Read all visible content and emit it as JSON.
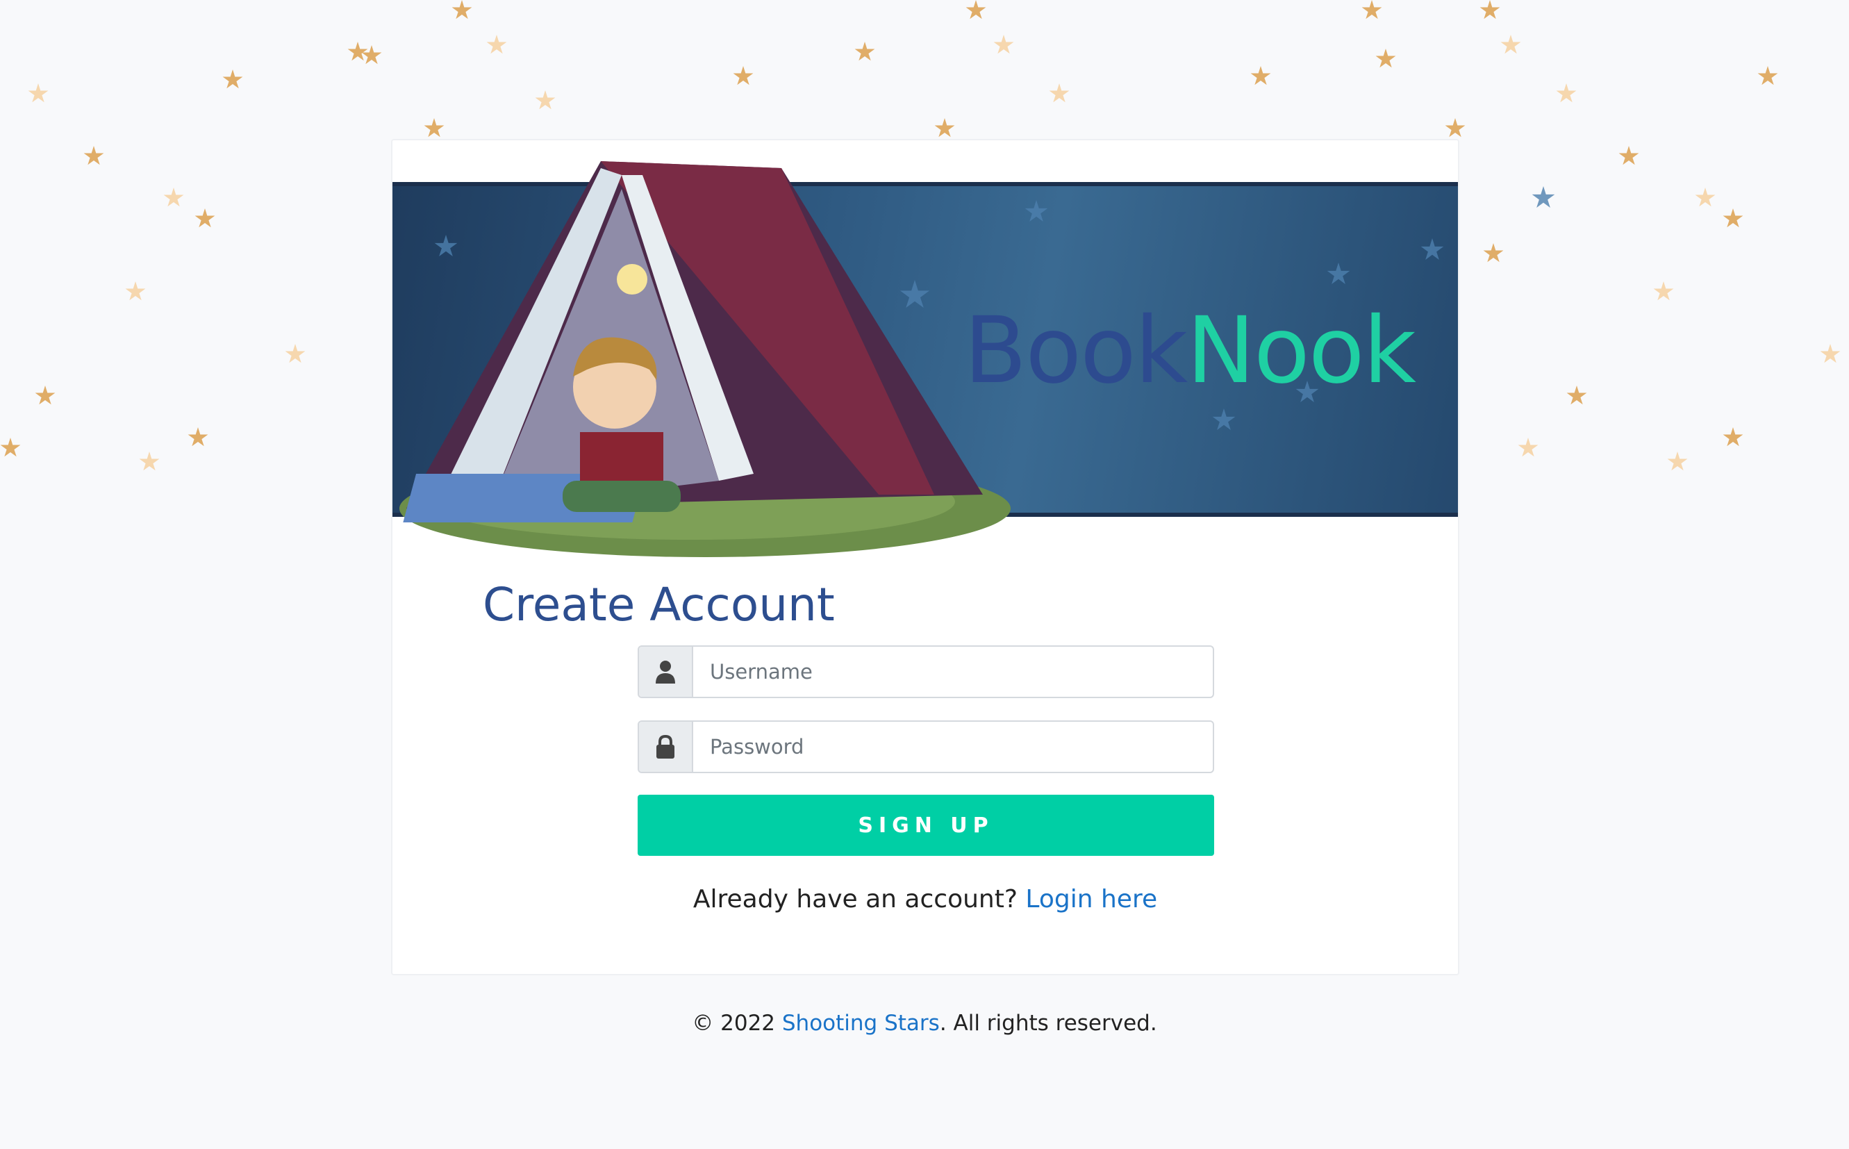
{
  "brand": {
    "part1": "Book",
    "part2": "Nook"
  },
  "form": {
    "title": "Create Account",
    "username_placeholder": "Username",
    "password_placeholder": "Password",
    "submit_label": "SIGN UP",
    "login_prompt": "Already have an account?",
    "login_link": "Login here"
  },
  "footer": {
    "prefix": "© 2022",
    "company": "Shooting Stars",
    "suffix": ". All rights reserved."
  },
  "colors": {
    "brand_dark": "#2d4b8f",
    "brand_accent": "#1fd0a3",
    "button": "#00cfa5",
    "link": "#1a73c8",
    "background": "#f8f9fb"
  },
  "icons": {
    "username": "user-icon",
    "password": "lock-icon"
  }
}
